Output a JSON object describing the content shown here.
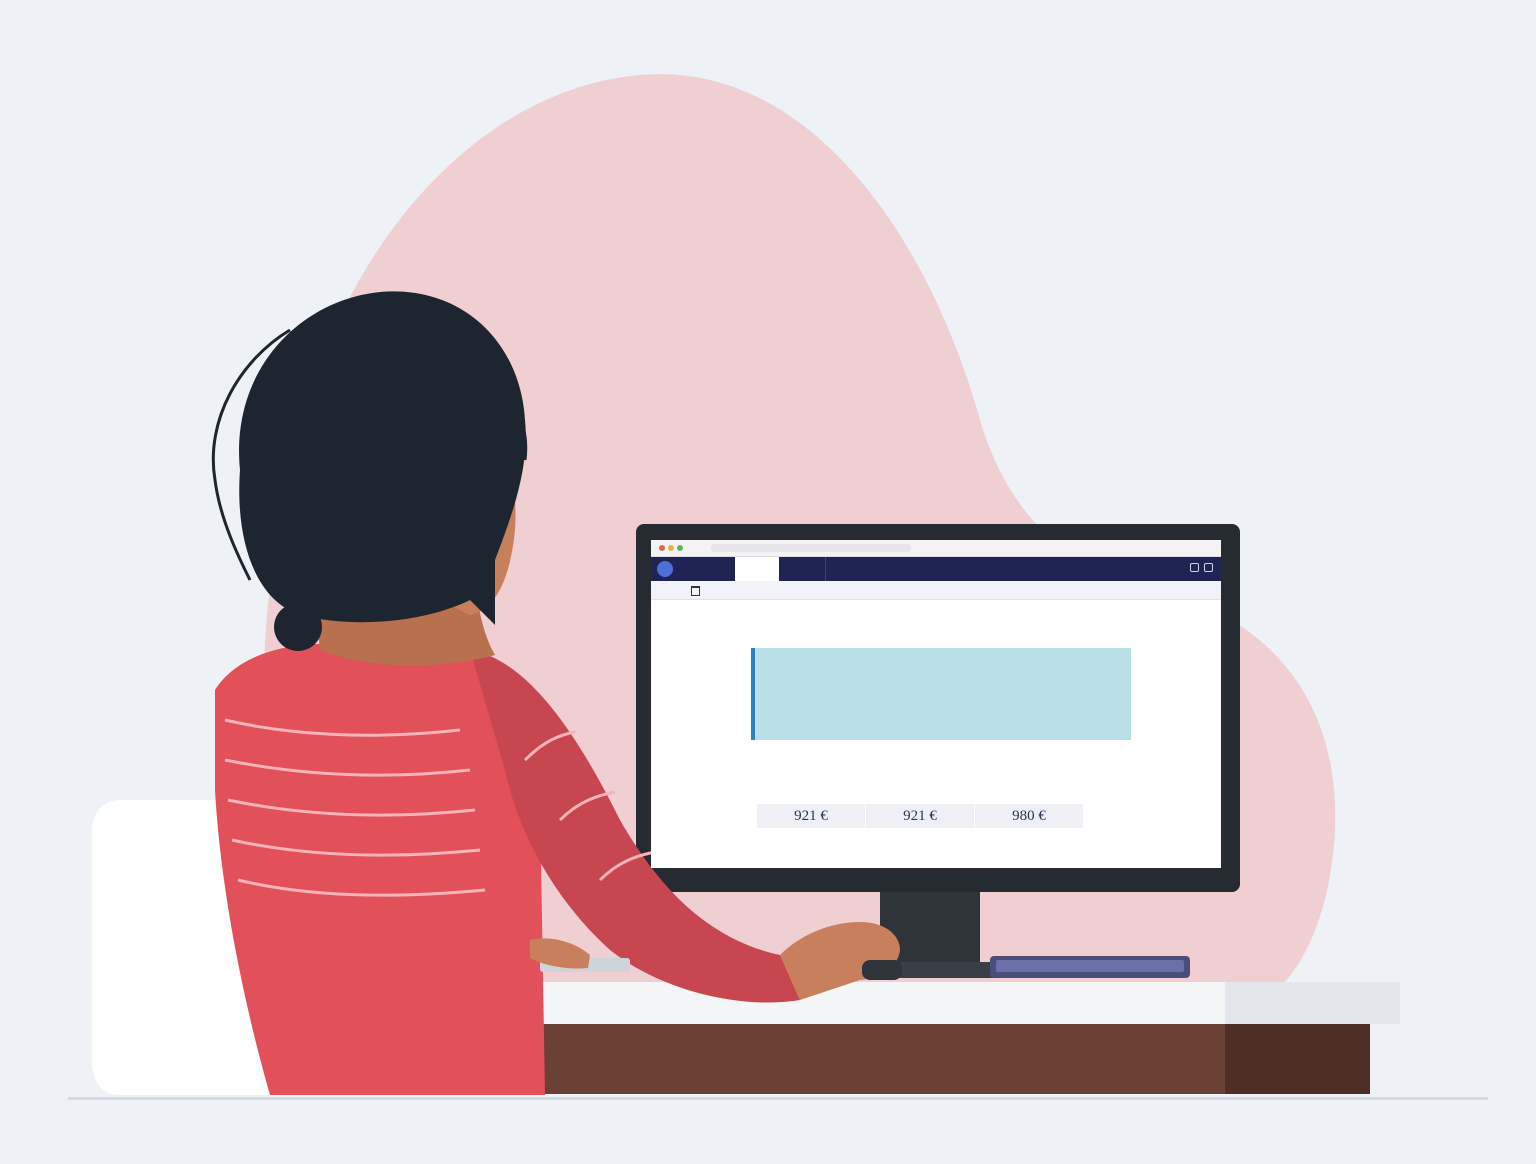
{
  "scene": {
    "description_free": true,
    "colors": {
      "background": "#eef2f6",
      "blob": "#efcfd2",
      "hair": "#1d2530",
      "skin": "#c77f5c",
      "shirt": "#e2505a",
      "shirt_shadow": "#c84650",
      "chair": "#ffffff",
      "desk_top": "#f4f5f7",
      "desk_front": "#6b4035",
      "monitor": "#262a31",
      "screen_header": "#1f2452",
      "info_box": "#b9e0e6"
    }
  },
  "screen": {
    "brand_text": "",
    "nav_tabs": [
      "",
      "",
      ""
    ],
    "subnav_items": [
      "",
      "",
      "",
      ""
    ],
    "page_title": "",
    "info_lines": [
      "",
      "",
      "",
      "",
      "",
      ""
    ],
    "section_title": "",
    "section_sub": "",
    "tiles": [
      {
        "label": "",
        "value": "921 €"
      },
      {
        "label": "",
        "value": "921 €"
      },
      {
        "label": "",
        "value": "980 €"
      }
    ]
  }
}
